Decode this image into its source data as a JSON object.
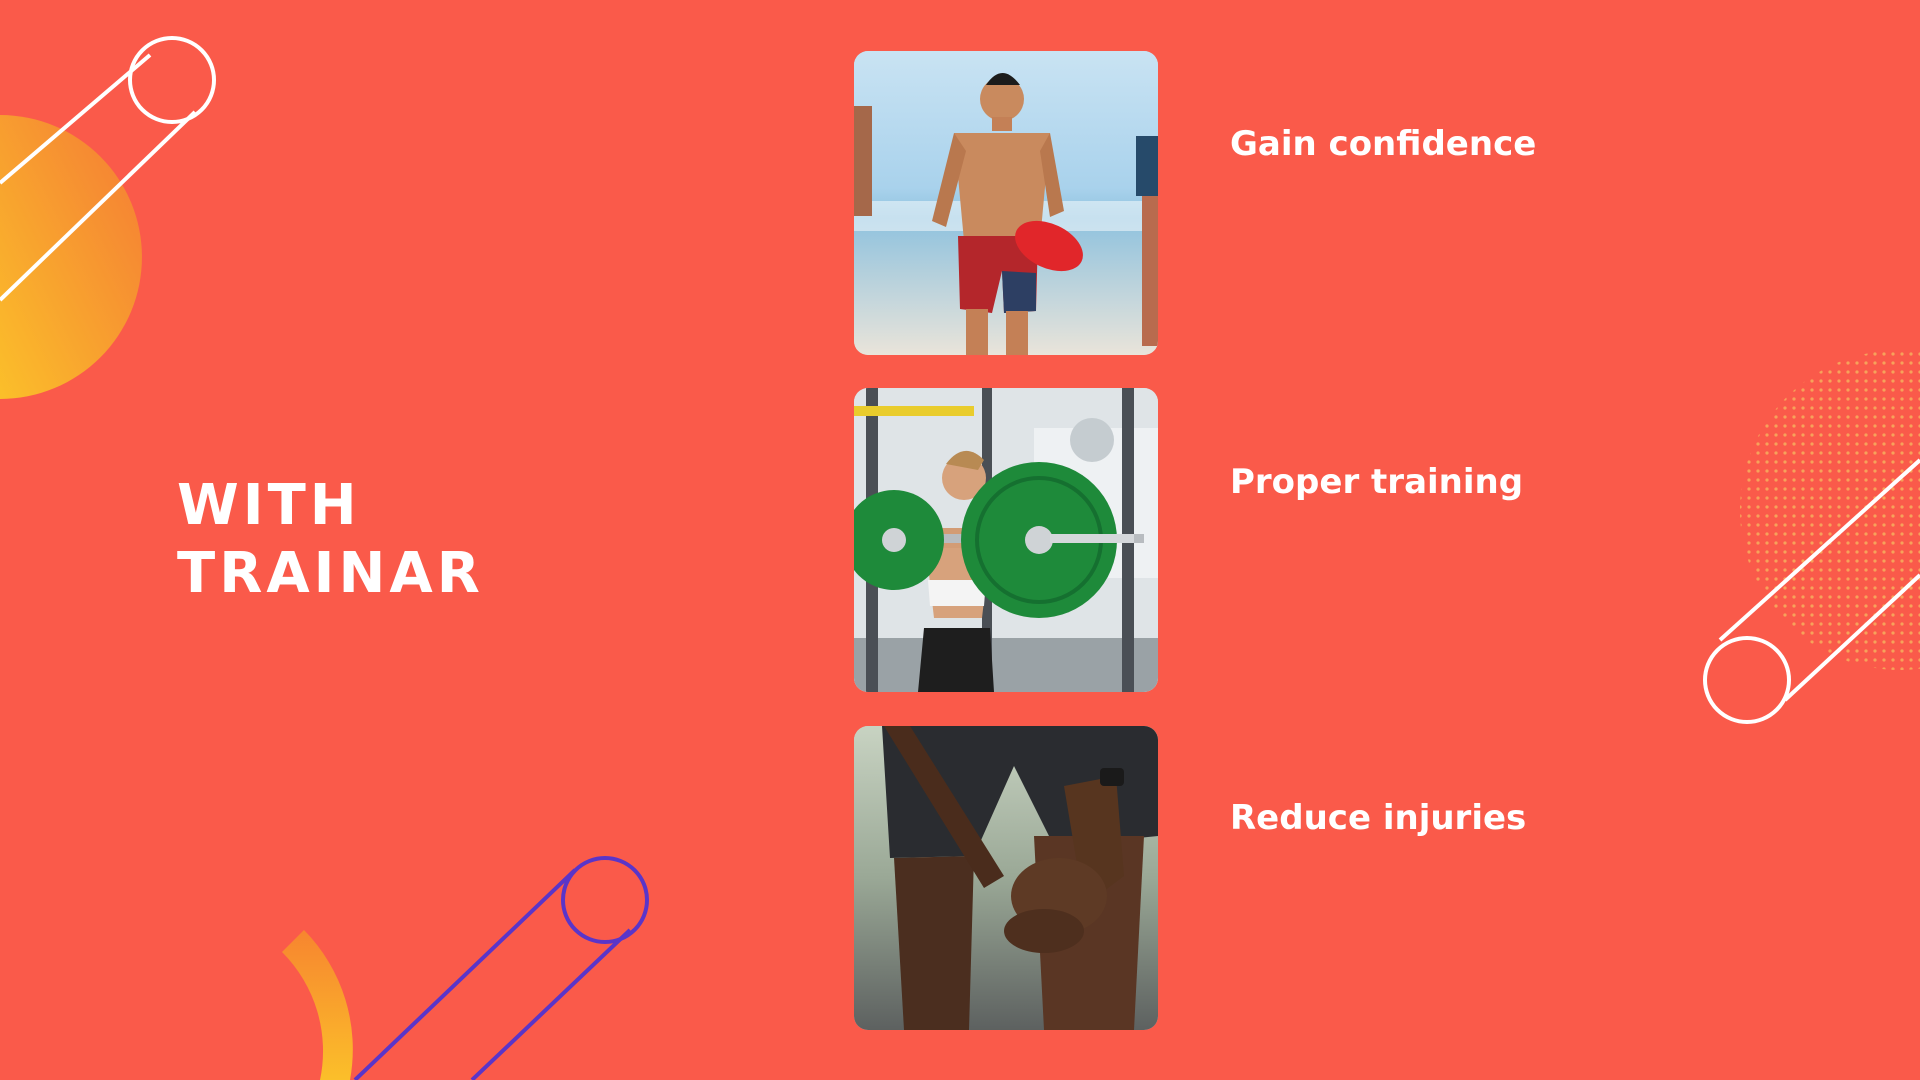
{
  "colors": {
    "background": "#fa5a4a",
    "accent_orange": "#f7852f",
    "accent_yellow": "#fbbf2a",
    "accent_purple": "#5a35c9",
    "text": "#ffffff"
  },
  "heading": {
    "line1": "WITH",
    "line2": "TRAINAR"
  },
  "benefits": [
    {
      "label": "Gain confidence",
      "image": "beach-runner-photo"
    },
    {
      "label": "Proper training",
      "image": "barbell-squat-photo"
    },
    {
      "label": "Reduce injuries",
      "image": "knee-pain-photo"
    }
  ]
}
